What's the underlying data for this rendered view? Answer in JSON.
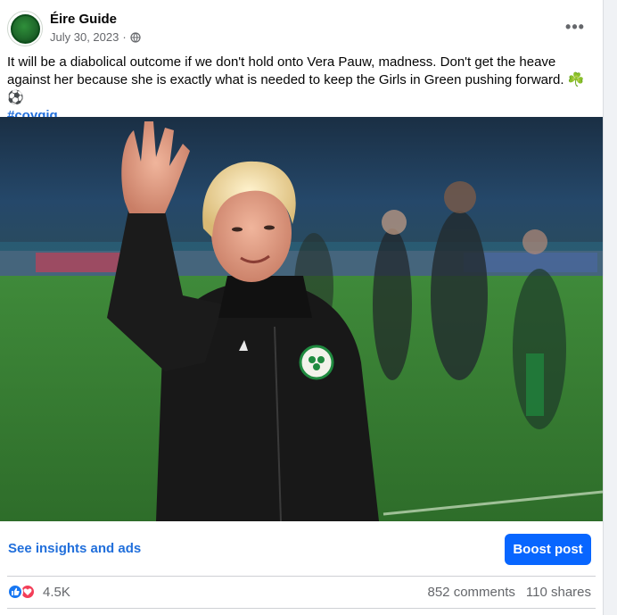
{
  "post": {
    "author": "Éire Guide",
    "date": "July 30, 2023",
    "separator": "·",
    "privacy_icon": "globe-icon",
    "more_icon": "more-options-icon",
    "more_label": "•••",
    "text": "It will be a diabolical outcome if we don't hold onto Vera Pauw, madness. Don't get the heave against her because she is exactly what is needed to keep the Girls in Green pushing forward. ☘️⚽",
    "hashtag": "#coygig",
    "image_subject": "photo-woman-waving-on-pitch"
  },
  "actions": {
    "insights_label": "See insights and ads",
    "boost_label": "Boost post"
  },
  "engagement": {
    "reaction_icons": [
      "like-icon",
      "love-icon"
    ],
    "reaction_count": "4.5K",
    "comments": "852 comments",
    "shares": "110 shares"
  },
  "colors": {
    "link": "#216fdb",
    "boost": "#0866ff",
    "like": "#1877f2",
    "love": "#f33e58",
    "muted_text": "#65676b"
  }
}
